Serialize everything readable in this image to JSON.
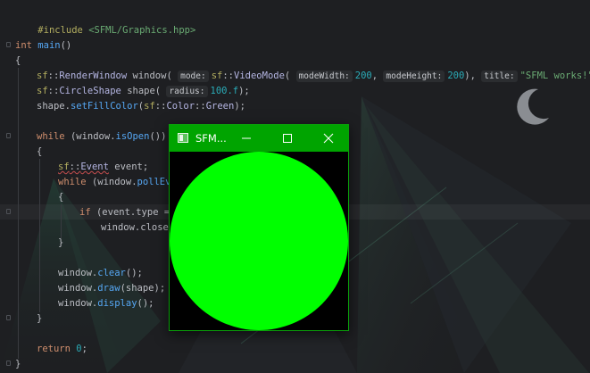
{
  "code": {
    "include_directive": "#include",
    "include_path": "<SFML/Graphics.hpp>",
    "kw_int": "int",
    "fn_main": "main",
    "parens_empty": "()",
    "brace_open": "{",
    "brace_close": "}",
    "ns_sf": "sf",
    "scope": "::",
    "type_renderwindow": "RenderWindow",
    "var_window": "window",
    "paren_open": "(",
    "hint_mode": "mode:",
    "type_videomode": "VideoMode",
    "hint_modewidth": "modeWidth:",
    "num_200a": "200",
    "comma": ",",
    "hint_modeheight": "modeHeight:",
    "num_200b": "200",
    "paren_close_comma": "),",
    "hint_title": "title:",
    "str_title": "\"SFML works!\"",
    "stmt_end": ");",
    "type_circleshape": "CircleShape",
    "var_shape": "shape",
    "hint_radius": "radius:",
    "num_radius": "100.f",
    "call_setfill_obj": "shape.",
    "fn_setfillcolor": "setFillColor",
    "type_color": "Color",
    "const_green": "Green",
    "paren_close": ")",
    "stmt_end2": ");",
    "kw_while": "while",
    "window_dot": "(window.",
    "fn_isopen": "isOpen",
    "parens_close2": "())",
    "type_event": "Event",
    "var_event": "event;",
    "kw_while2": "while",
    "fn_pollevent": "pollEve",
    "kw_if": "if",
    "event_type": "(event.type ==",
    "window_close": "window.close(",
    "window_clear_obj": "window.",
    "fn_clear": "clear",
    "fn_draw": "draw",
    "draw_arg": "(shape);",
    "fn_display": "display",
    "call_end": "();",
    "kw_return": "return",
    "num_zero": "0",
    "semicolon": ";"
  },
  "sfml_window": {
    "title": "SFM...",
    "circle_color": "#00ff00",
    "titlebar_color": "#00a400",
    "min_icon": "minimize-icon",
    "max_icon": "maximize-icon",
    "close_icon": "close-icon"
  },
  "colors": {
    "editor_bg": "#1e1f22",
    "keyword": "#cf8e6d",
    "function": "#56a8f5",
    "type": "#b5b6e3",
    "number": "#2aacb8",
    "string": "#6aab73"
  }
}
